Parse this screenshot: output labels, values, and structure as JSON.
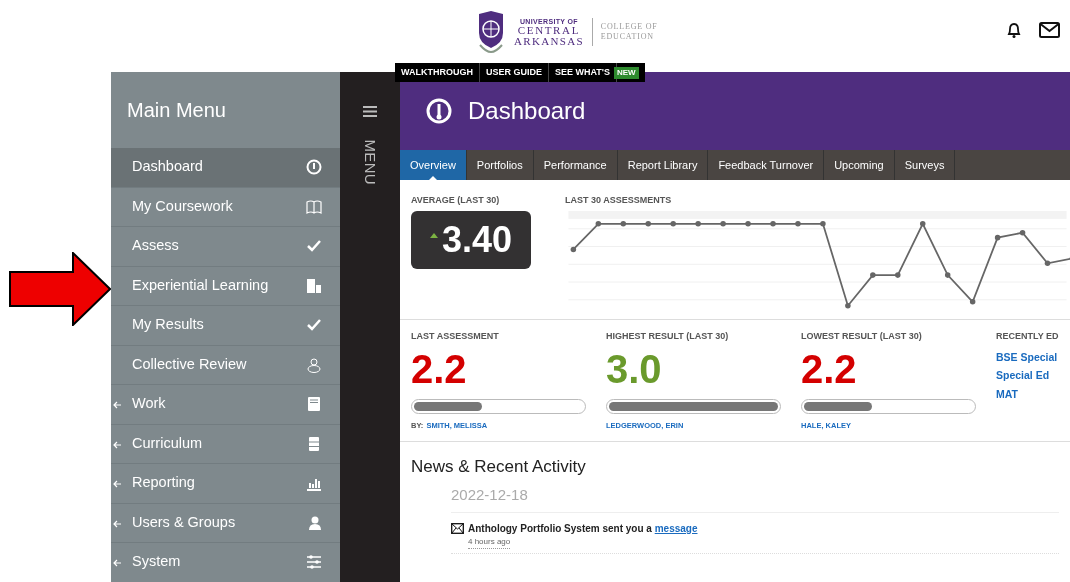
{
  "header": {
    "logo": {
      "line_1": "UNIVERSITY OF",
      "line_2": "CENTRAL",
      "line_3": "ARKANSAS",
      "college": "COLLEGE OF EDUCATION"
    }
  },
  "help_bar": {
    "links": [
      "WALKTHROUGH",
      "USER GUIDE",
      "SEE WHAT'S"
    ],
    "badge": "NEW"
  },
  "sidebar": {
    "title": "Main Menu",
    "items": [
      {
        "label": "Dashboard",
        "selected": true,
        "has_submenu": false
      },
      {
        "label": "My Coursework",
        "selected": false,
        "has_submenu": false
      },
      {
        "label": "Assess",
        "selected": false,
        "has_submenu": false
      },
      {
        "label": "Experiential Learning",
        "selected": false,
        "has_submenu": false
      },
      {
        "label": "My Results",
        "selected": false,
        "has_submenu": false
      },
      {
        "label": "Collective Review",
        "selected": false,
        "has_submenu": false
      },
      {
        "label": "Work",
        "selected": false,
        "has_submenu": true
      },
      {
        "label": "Curriculum",
        "selected": false,
        "has_submenu": true
      },
      {
        "label": "Reporting",
        "selected": false,
        "has_submenu": true
      },
      {
        "label": "Users & Groups",
        "selected": false,
        "has_submenu": true
      },
      {
        "label": "System",
        "selected": false,
        "has_submenu": true
      }
    ]
  },
  "menu_rail": {
    "label": "MENU"
  },
  "page": {
    "title": "Dashboard"
  },
  "tabs": [
    {
      "label": "Overview",
      "selected": true
    },
    {
      "label": "Portfolios",
      "selected": false
    },
    {
      "label": "Performance",
      "selected": false
    },
    {
      "label": "Report Library",
      "selected": false
    },
    {
      "label": "Feedback Turnover",
      "selected": false
    },
    {
      "label": "Upcoming",
      "selected": false
    },
    {
      "label": "Surveys",
      "selected": false
    }
  ],
  "average": {
    "label": "AVERAGE (LAST 30)",
    "value": "3.40"
  },
  "trend": {
    "label": "LAST 30 ASSESSMENTS"
  },
  "stats": [
    {
      "label": "LAST ASSESSMENT",
      "value": "2.2",
      "color": "#d40000",
      "level": 0.4,
      "by_label": "BY:",
      "name": "SMITH, MELISSA"
    },
    {
      "label": "HIGHEST RESULT (LAST 30)",
      "value": "3.0",
      "color": "#6a9a2c",
      "level": 1.0,
      "name": "LEDGERWOOD, ERIN"
    },
    {
      "label": "LOWEST RESULT (LAST 30)",
      "value": "2.2",
      "color": "#d40000",
      "level": 0.4,
      "name": "HALE, KALEY"
    }
  ],
  "recent": {
    "label": "RECENTLY ED",
    "links": [
      "BSE Special",
      "Special Ed",
      "MAT"
    ]
  },
  "news": {
    "title": "News & Recent Activity",
    "date": "2022-12-18",
    "items": [
      {
        "text": "Anthology Portfolio System sent you a ",
        "link": "message",
        "time": "4 hours ago"
      }
    ]
  }
}
